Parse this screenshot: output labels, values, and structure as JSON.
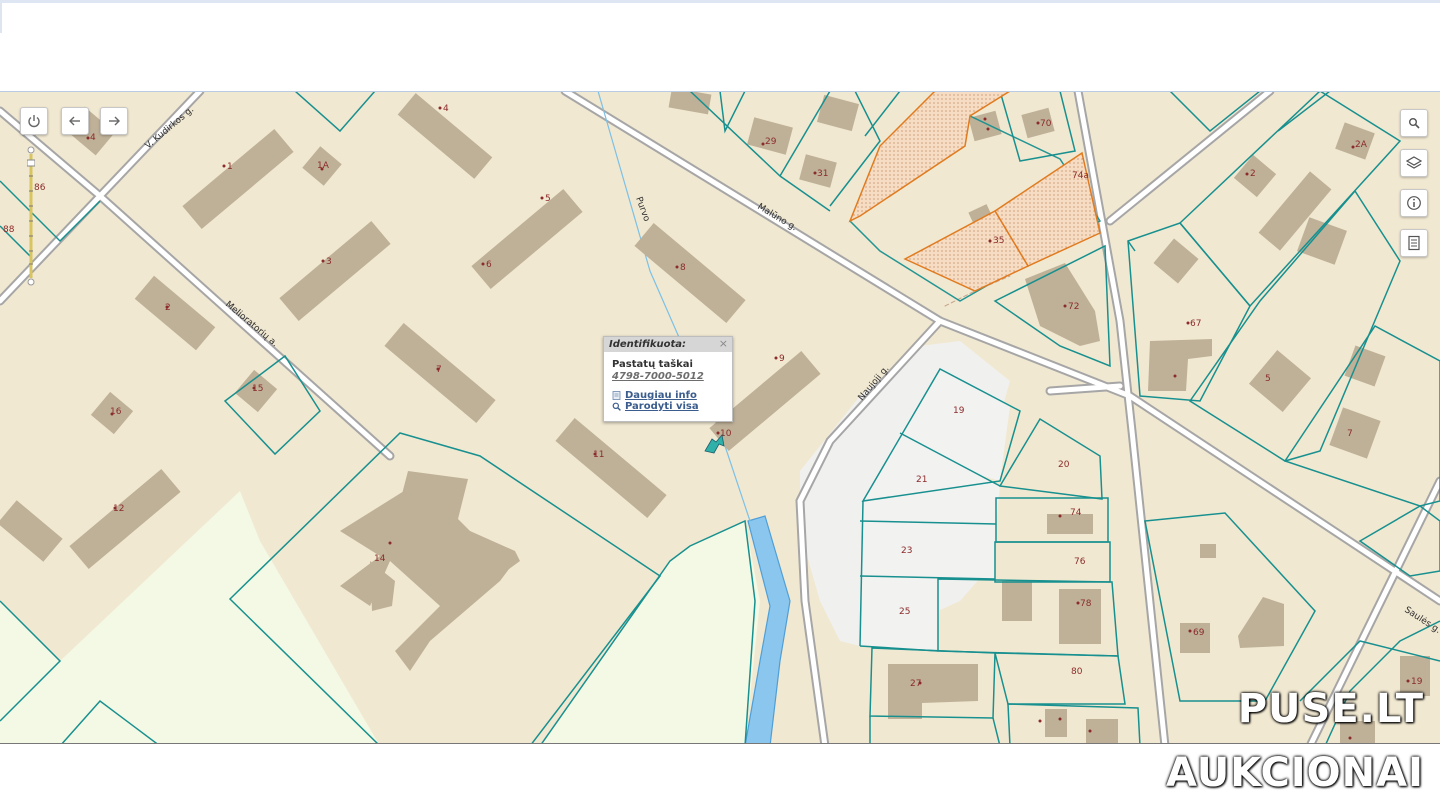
{
  "map": {
    "street_labels": {
      "kudirkos": "V. Kudirkos g.",
      "purvo": "Purvo",
      "malūno": "Malūno g.",
      "melioratoriu": "Melioratorių a.",
      "naujoji": "Naujoji g.",
      "saules": "Saulės g."
    },
    "house_numbers": {
      "h4": "4",
      "h1": "1",
      "h1a": "1A",
      "h5": "5",
      "h3": "3",
      "h6": "6",
      "h8": "8",
      "h2": "2",
      "h7": "7",
      "h9": "9",
      "h15": "15",
      "h16": "16",
      "h11": "11",
      "h10": "10",
      "h12": "12",
      "h14": "14",
      "h29": "29",
      "h31": "31",
      "h70": "70",
      "h74a": "74a",
      "h35": "35",
      "h72": "72",
      "h2a": "2A",
      "h2r": "2",
      "h67": "67",
      "h5r": "5",
      "h7r": "7",
      "h19": "19",
      "h20": "20",
      "h21": "21",
      "h74": "74",
      "h23": "23",
      "h76": "76",
      "h25": "25",
      "h78": "78",
      "h27": "27",
      "h80": "80",
      "h69": "69",
      "h19r": "19",
      "h86": "86",
      "h88": "88",
      "h4l": "4"
    },
    "colors": {
      "background": "#f1e8d1",
      "building": "#bfb198",
      "parcel_line": "#17908f",
      "highlight": "#e07b20",
      "water": "#8ac6ee",
      "green": "#f3f9e4"
    }
  },
  "controls": {
    "left": [
      "power-icon",
      "arrow-left-icon",
      "arrow-right-icon"
    ],
    "right": [
      "search-icon",
      "layers-icon",
      "info-icon",
      "document-icon"
    ]
  },
  "popup": {
    "header": "Identifikuota:",
    "close": "×",
    "title": "Pastatų taškai",
    "code": "4798-7000-5012",
    "link_more": "Daugiau info",
    "link_show": "Parodyti visa"
  },
  "watermark": {
    "line1": "PUSE.LT",
    "line2": "AUKCIONAI"
  }
}
